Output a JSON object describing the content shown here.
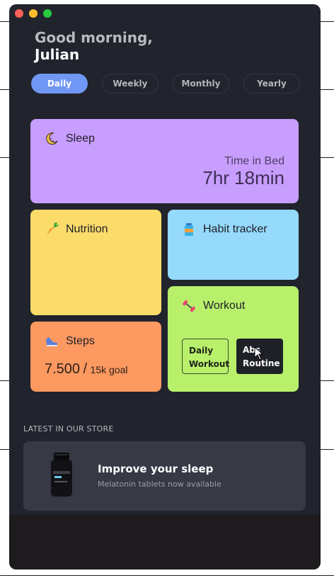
{
  "window": {
    "traffic_lights": [
      "#fe5f57",
      "#febc2e",
      "#28c840"
    ]
  },
  "greeting": {
    "line1": "Good morning,",
    "line2": "Julian"
  },
  "tabs": [
    {
      "label": "Daily",
      "active": true
    },
    {
      "label": "Weekly",
      "active": false
    },
    {
      "label": "Monthly",
      "active": false
    },
    {
      "label": "Yearly",
      "active": false
    }
  ],
  "cards": {
    "sleep": {
      "title": "Sleep",
      "icon": "crescent-moon-icon",
      "sub_label": "Time in Bed",
      "value": "7hr 18min",
      "color": "#c79dfd"
    },
    "nutrition": {
      "title": "Nutrition",
      "icon": "carrot-icon",
      "color": "#fbdb6a"
    },
    "habit": {
      "title": "Habit tracker",
      "icon": "water-bottle-icon",
      "color": "#95d9fb"
    },
    "workout": {
      "title": "Workout",
      "icon": "dumbbell-icon",
      "color": "#b8f06c",
      "buttons": [
        {
          "line1": "Daily",
          "line2": "Workout"
        },
        {
          "line1": "Abs",
          "line2": "Routine"
        }
      ]
    },
    "steps": {
      "title": "Steps",
      "icon": "sneaker-icon",
      "value": "7.500",
      "separator": "/",
      "goal": "15k goal",
      "color": "#fb9960"
    }
  },
  "store": {
    "section_label": "LATEST IN OUR STORE",
    "product_title": "Improve your sleep",
    "product_sub": "Melatonin tablets now available"
  }
}
